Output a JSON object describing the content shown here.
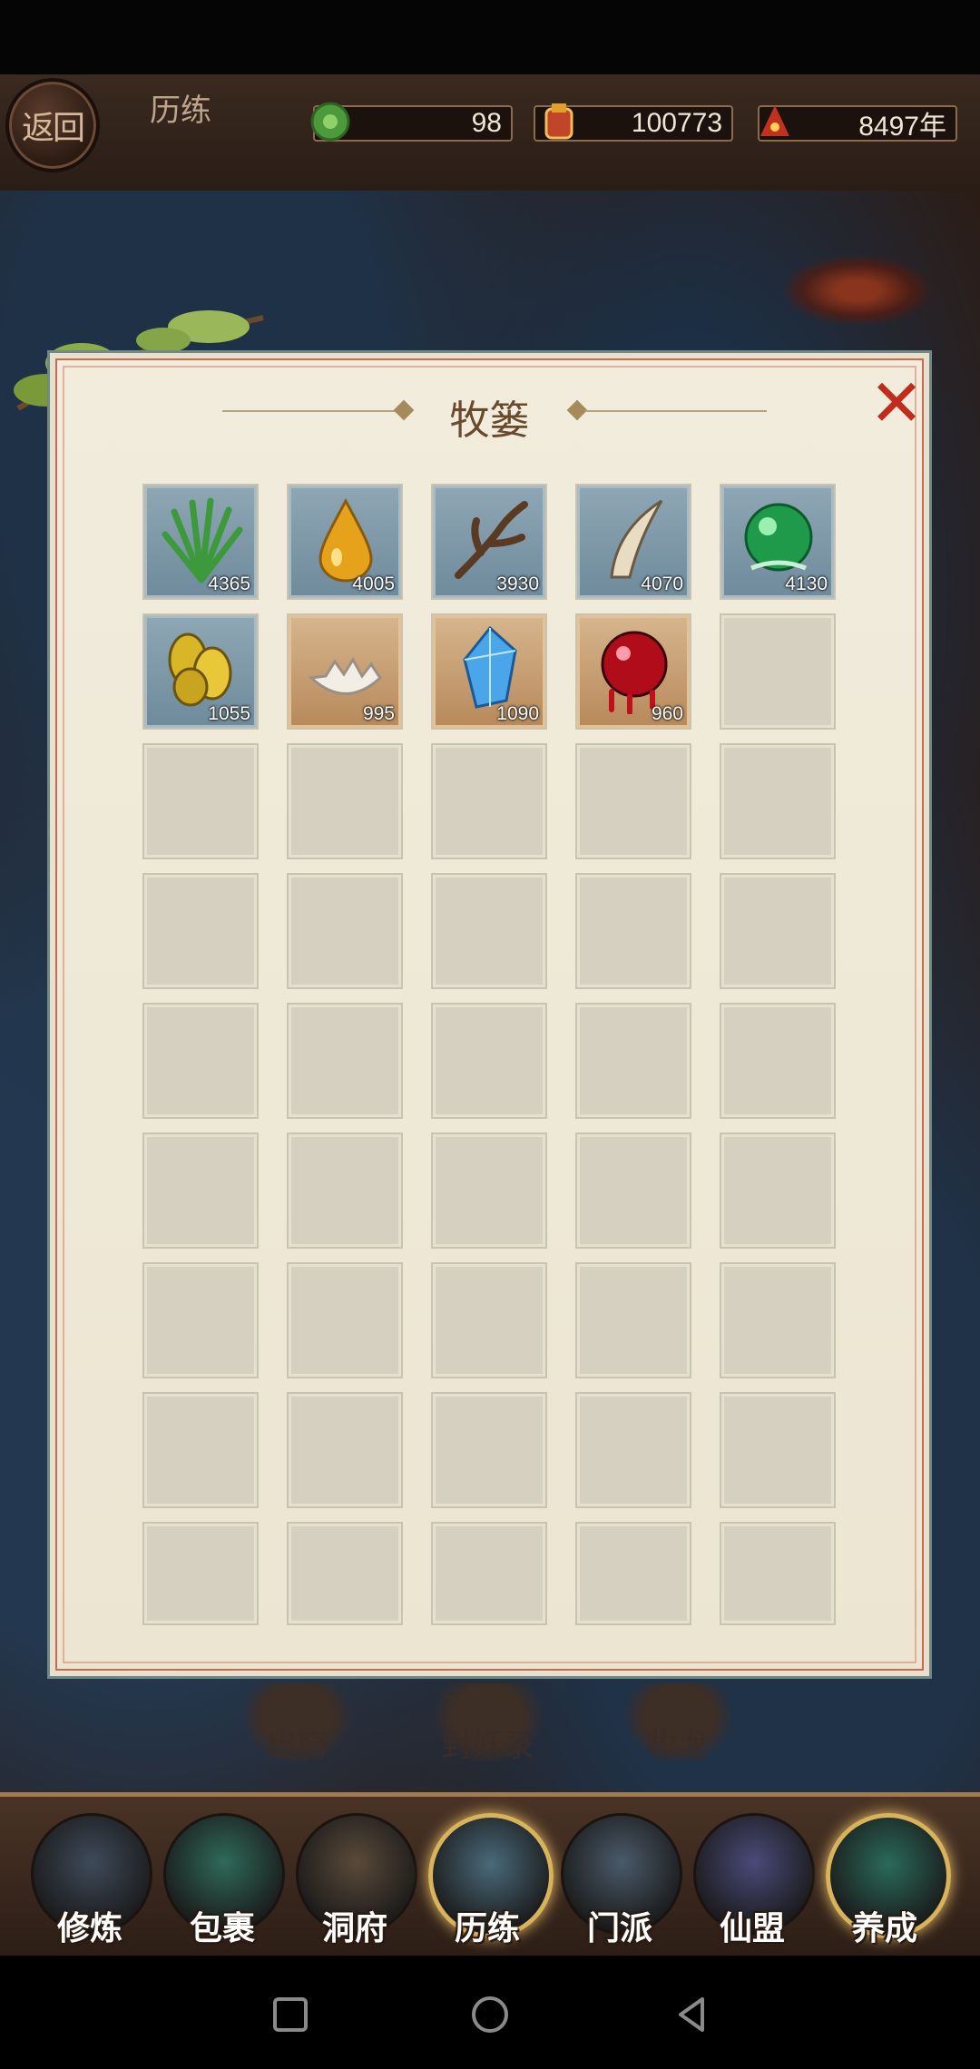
{
  "header": {
    "back_label": "返回",
    "title": "历练",
    "resources": [
      {
        "icon": "green-jade-icon",
        "value": "98"
      },
      {
        "icon": "treasure-pouch-icon",
        "value": "100773"
      },
      {
        "icon": "lifespan-icon",
        "value": "8497年"
      }
    ]
  },
  "panel": {
    "title": "牧篓",
    "close_icon": "close-icon",
    "items": [
      {
        "icon": "grass-icon",
        "count": "4365",
        "frame": "blue"
      },
      {
        "icon": "golden-drop-icon",
        "count": "4005",
        "frame": "blue"
      },
      {
        "icon": "branch-icon",
        "count": "3930",
        "frame": "blue"
      },
      {
        "icon": "horn-icon",
        "count": "4070",
        "frame": "blue"
      },
      {
        "icon": "green-orb-icon",
        "count": "4130",
        "frame": "blue"
      },
      {
        "icon": "gold-seeds-icon",
        "count": "1055",
        "frame": "blue"
      },
      {
        "icon": "eggshell-icon",
        "count": "995",
        "frame": "gold"
      },
      {
        "icon": "blue-crystal-icon",
        "count": "1090",
        "frame": "gold"
      },
      {
        "icon": "blood-orb-icon",
        "count": "960",
        "frame": "gold"
      }
    ]
  },
  "background_tabs": [
    "出窍",
    "封妖录",
    "牧龙"
  ],
  "nav": {
    "items": [
      {
        "label": "修炼",
        "icon": "cultivator-icon",
        "active": false
      },
      {
        "label": "包裹",
        "icon": "bag-icon",
        "active": false
      },
      {
        "label": "洞府",
        "icon": "cave-mansion-icon",
        "active": false
      },
      {
        "label": "历练",
        "icon": "scroll-icon",
        "active": true
      },
      {
        "label": "门派",
        "icon": "sect-gate-icon",
        "active": false
      },
      {
        "label": "仙盟",
        "icon": "alliance-icon",
        "active": false
      },
      {
        "label": "养成",
        "icon": "pentagram-icon",
        "active": true
      }
    ]
  },
  "system_nav": [
    "square-icon",
    "circle-icon",
    "triangle-back-icon"
  ],
  "colors": {
    "panel_bg": "#efe9d8",
    "close": "#c22c1d",
    "frame_blue": "#7c96a6",
    "frame_gold": "#c49a6a"
  }
}
